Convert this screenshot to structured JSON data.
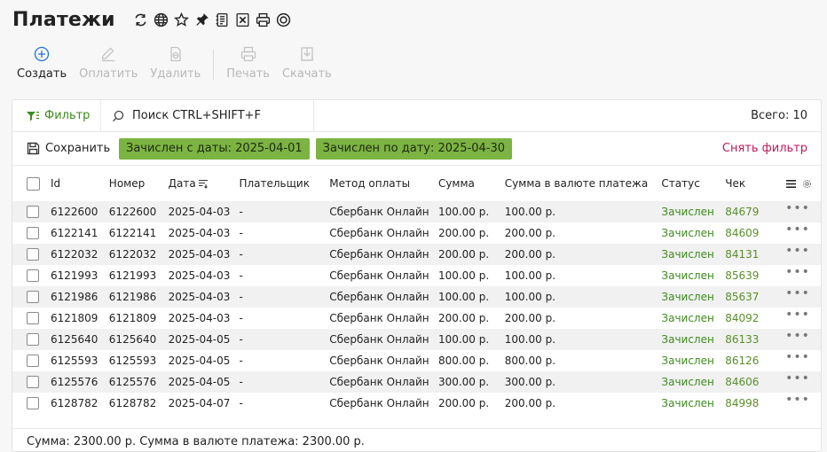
{
  "page": {
    "title": "Платежи",
    "title_icons": [
      "refresh-icon",
      "globe-icon",
      "star-icon",
      "pin-icon",
      "document-list-icon",
      "excel-export-icon",
      "printer-icon",
      "help-circle-icon"
    ]
  },
  "toolbar": {
    "create_label": "Создать",
    "pay_label": "Оплатить",
    "delete_label": "Удалить",
    "print_label": "Печать",
    "download_label": "Скачать"
  },
  "filter_bar": {
    "filter_label": "Фильтр",
    "search_placeholder": "Поиск CTRL+SHIFT+F",
    "total_label": "Всего: 10",
    "save_label": "Сохранить",
    "chip_from": "Зачислен с даты: 2025-04-01",
    "chip_to": "Зачислен по дату: 2025-04-30",
    "clear_label": "Снять фильтр"
  },
  "table": {
    "columns": {
      "id": "Id",
      "number": "Номер",
      "date": "Дата",
      "payer": "Плательщик",
      "method": "Метод оплаты",
      "sum": "Сумма",
      "currency_sum": "Сумма в валюте платежа",
      "status": "Статус",
      "check": "Чек"
    },
    "rows": [
      {
        "id": "6122600",
        "number": "6122600",
        "date": "2025-04-03",
        "payer": "-",
        "method": "Сбербанк Онлайн",
        "sum": "100.00 р.",
        "currency_sum": "100.00 р.",
        "status": "Зачислен",
        "check": "84679",
        "actions": "•••"
      },
      {
        "id": "6122141",
        "number": "6122141",
        "date": "2025-04-03",
        "payer": "-",
        "method": "Сбербанк Онлайн",
        "sum": "200.00 р.",
        "currency_sum": "200.00 р.",
        "status": "Зачислен",
        "check": "84609",
        "actions": "•••"
      },
      {
        "id": "6122032",
        "number": "6122032",
        "date": "2025-04-03",
        "payer": "-",
        "method": "Сбербанк Онлайн",
        "sum": "200.00 р.",
        "currency_sum": "200.00 р.",
        "status": "Зачислен",
        "check": "84131",
        "actions": "•••"
      },
      {
        "id": "6121993",
        "number": "6121993",
        "date": "2025-04-03",
        "payer": "-",
        "method": "Сбербанк Онлайн",
        "sum": "100.00 р.",
        "currency_sum": "100.00 р.",
        "status": "Зачислен",
        "check": "85639",
        "actions": "•••"
      },
      {
        "id": "6121986",
        "number": "6121986",
        "date": "2025-04-03",
        "payer": "-",
        "method": "Сбербанк Онлайн",
        "sum": "100.00 р.",
        "currency_sum": "100.00 р.",
        "status": "Зачислен",
        "check": "85637",
        "actions": "•••"
      },
      {
        "id": "6121809",
        "number": "6121809",
        "date": "2025-04-03",
        "payer": "-",
        "method": "Сбербанк Онлайн",
        "sum": "200.00 р.",
        "currency_sum": "200.00 р.",
        "status": "Зачислен",
        "check": "84092",
        "actions": "•••"
      },
      {
        "id": "6125640",
        "number": "6125640",
        "date": "2025-04-05",
        "payer": "-",
        "method": "Сбербанк Онлайн",
        "sum": "100.00 р.",
        "currency_sum": "100.00 р.",
        "status": "Зачислен",
        "check": "86133",
        "actions": "•••"
      },
      {
        "id": "6125593",
        "number": "6125593",
        "date": "2025-04-05",
        "payer": "-",
        "method": "Сбербанк Онлайн",
        "sum": "800.00 р.",
        "currency_sum": "800.00 р.",
        "status": "Зачислен",
        "check": "86126",
        "actions": "•••"
      },
      {
        "id": "6125576",
        "number": "6125576",
        "date": "2025-04-05",
        "payer": "-",
        "method": "Сбербанк Онлайн",
        "sum": "300.00 р.",
        "currency_sum": "300.00 р.",
        "status": "Зачислен",
        "check": "84606",
        "actions": "•••"
      },
      {
        "id": "6128782",
        "number": "6128782",
        "date": "2025-04-07",
        "payer": "-",
        "method": "Сбербанк Онлайн",
        "sum": "200.00 р.",
        "currency_sum": "200.00 р.",
        "status": "Зачислен",
        "check": "84998",
        "actions": "•••"
      }
    ]
  },
  "footer": {
    "summary": "Сумма: 2300.00 р. Сумма в валюте платежа: 2300.00 р."
  },
  "colors": {
    "chip_bg": "#7cb342",
    "status_green": "#3d8a1f",
    "clear_filter": "#c2185b",
    "create_icon": "#1e73d6"
  }
}
